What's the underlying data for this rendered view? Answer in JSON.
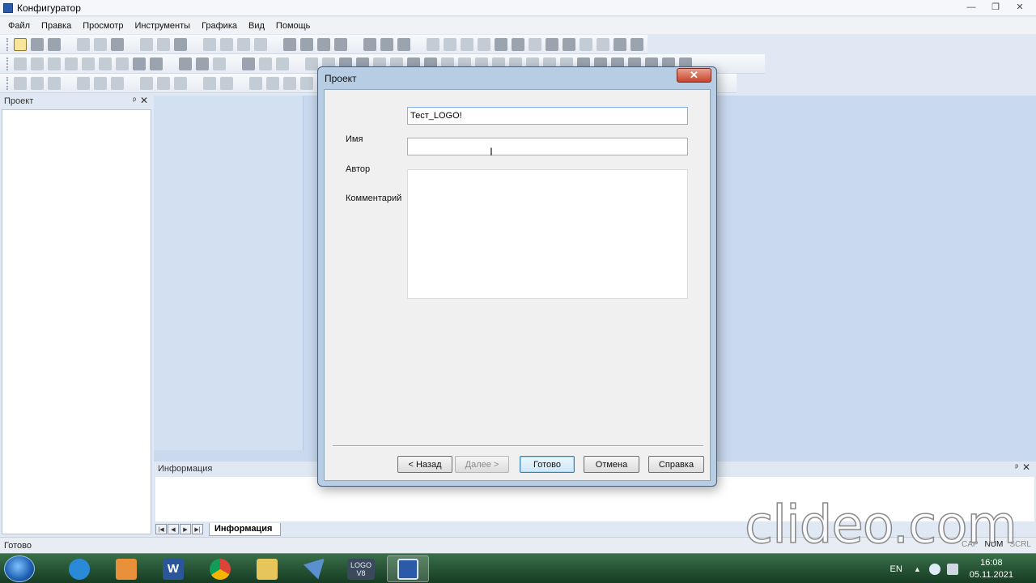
{
  "app": {
    "title": "Конфигуратор",
    "window_buttons": [
      "—",
      "❐",
      "✕"
    ]
  },
  "menu": [
    "Файл",
    "Правка",
    "Просмотр",
    "Инструменты",
    "Графика",
    "Вид",
    "Помощь"
  ],
  "left_panel": {
    "title": "Проект",
    "pin": "ᵖ",
    "close": "✕"
  },
  "info_panel": {
    "title": "Информация",
    "pin": "ᵖ",
    "close": "✕",
    "tab": "Информация",
    "nav": [
      "|◀",
      "◀",
      "▶",
      "▶|"
    ]
  },
  "status": {
    "text": "Готово",
    "indicators": [
      "CAP",
      "NUM",
      "SCRL"
    ]
  },
  "dialog": {
    "title": "Проект",
    "close_glyph": "✕",
    "fields": {
      "name_label": "Имя",
      "name_value": "Тест_LOGO!",
      "author_label": "Автор",
      "author_value": "",
      "comment_label": "Комментарий",
      "comment_value": ""
    },
    "cursor_glyph": "I",
    "buttons": {
      "back": "< Назад",
      "next": "Далее >",
      "finish": "Готово",
      "cancel": "Отмена",
      "help": "Справка"
    }
  },
  "watermark": "clideo.com",
  "taskbar": {
    "apps": [
      {
        "name": "internet-explorer",
        "color": "#2b8ad8"
      },
      {
        "name": "media-player",
        "color": "#e8903a"
      },
      {
        "name": "word",
        "color": "#2b579a",
        "label": "W"
      },
      {
        "name": "chrome",
        "color": "#db4437"
      },
      {
        "name": "explorer",
        "color": "#e6c65a"
      },
      {
        "name": "logo-tool",
        "color": "#5a8fd0"
      },
      {
        "name": "logo-v8",
        "color": "#3a4a5c",
        "label": "LOGO V8"
      },
      {
        "name": "configurator",
        "color": "#2a5aa8"
      }
    ],
    "lang": "EN",
    "time": "16:08",
    "date": "05.11.2021"
  }
}
